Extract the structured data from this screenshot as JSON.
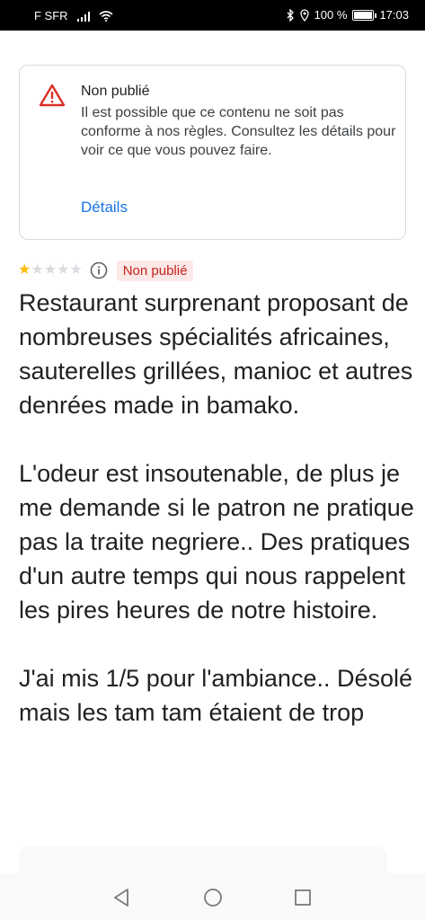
{
  "status_bar": {
    "carrier": "F SFR",
    "battery_text": "100 %",
    "time": "17:03"
  },
  "notice": {
    "title": "Non publié",
    "body": "Il est possible que ce contenu ne soit pas conforme à nos règles. Consultez les détails pour voir ce que vous pouvez faire.",
    "link_label": "Détails",
    "icon": "warning-icon"
  },
  "review": {
    "rating": 1,
    "max_rating": 5,
    "badge": "Non publié",
    "paragraphs": [
      "Restaurant surprenant proposant de nombreuses spécialités africaines, sauterelles grillées, manioc et autres denrées made in bamako.",
      "L'odeur est insoutenable, de plus je me demande si le patron ne pratique pas la traite negriere.. Des pratiques d'un autre temps qui nous rappelent les pires heures de notre histoire.",
      "J'ai mis 1/5 pour l'ambiance.. Désolé mais les tam tam étaient de trop"
    ]
  },
  "colors": {
    "link": "#1a73e8",
    "badge_bg": "#fce8e6",
    "badge_text": "#c5221f",
    "star_on": "#fbbc04",
    "warning": "#d93025"
  }
}
